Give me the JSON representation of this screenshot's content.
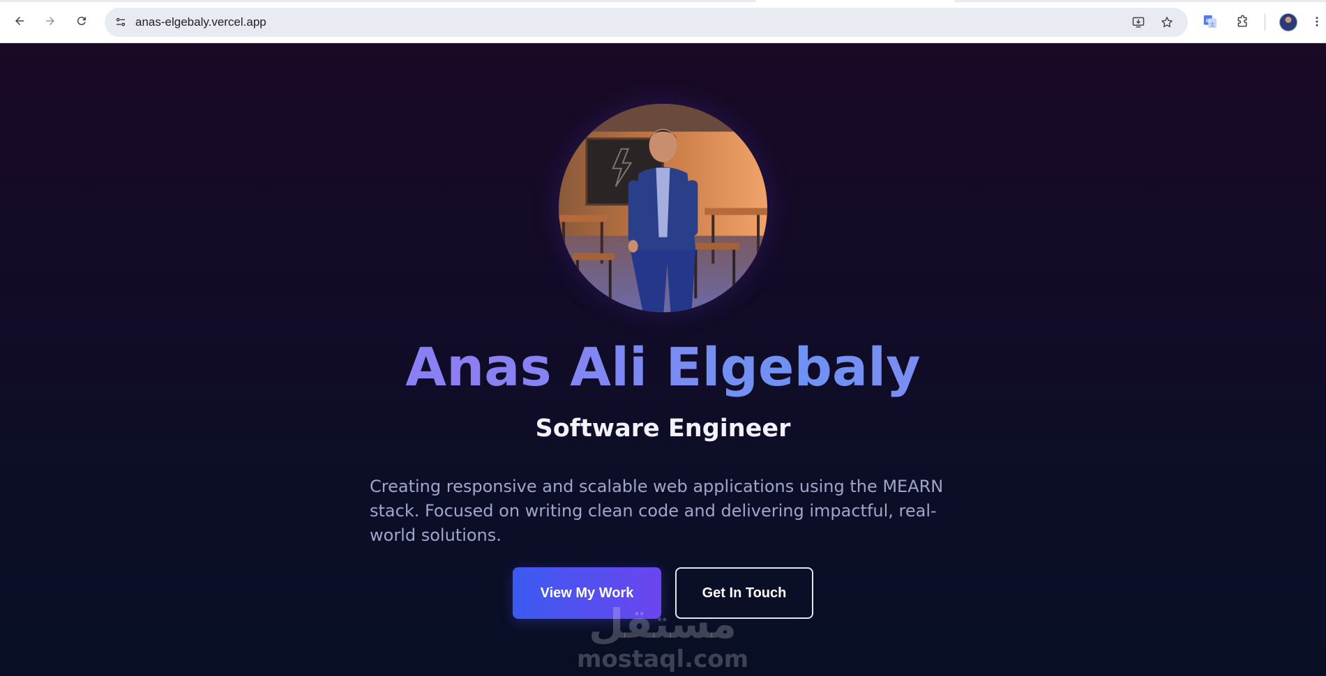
{
  "browser": {
    "url": "anas-elgebaly.vercel.app",
    "nav": {
      "back_icon": "arrow-left-icon",
      "forward_icon": "arrow-right-icon",
      "reload_icon": "reload-icon"
    },
    "omnibox_icons": [
      "site-info-icon",
      "install-app-icon",
      "bookmark-star-icon"
    ],
    "toolbar_icons": [
      "google-translate-icon",
      "extensions-puzzle-icon",
      "profile-avatar",
      "kebab-menu-icon"
    ]
  },
  "hero": {
    "name": "Anas Ali Elgebaly",
    "role": "Software Engineer",
    "description": "Creating responsive and scalable web applications using the MEARN stack. Focused on writing clean code and delivering impactful, real-world solutions.",
    "primary_button": "View My Work",
    "secondary_button": "Get In Touch"
  },
  "watermark": {
    "arabic": "مستقل",
    "latin": "mostaql.com"
  },
  "colors": {
    "name_gradient_start": "#5e8ef7",
    "name_gradient_end": "#a779f3",
    "primary_button_start": "#3b5bf0",
    "primary_button_end": "#6b45ef",
    "page_background_top": "#190a26",
    "page_background_bottom": "#080f25"
  }
}
